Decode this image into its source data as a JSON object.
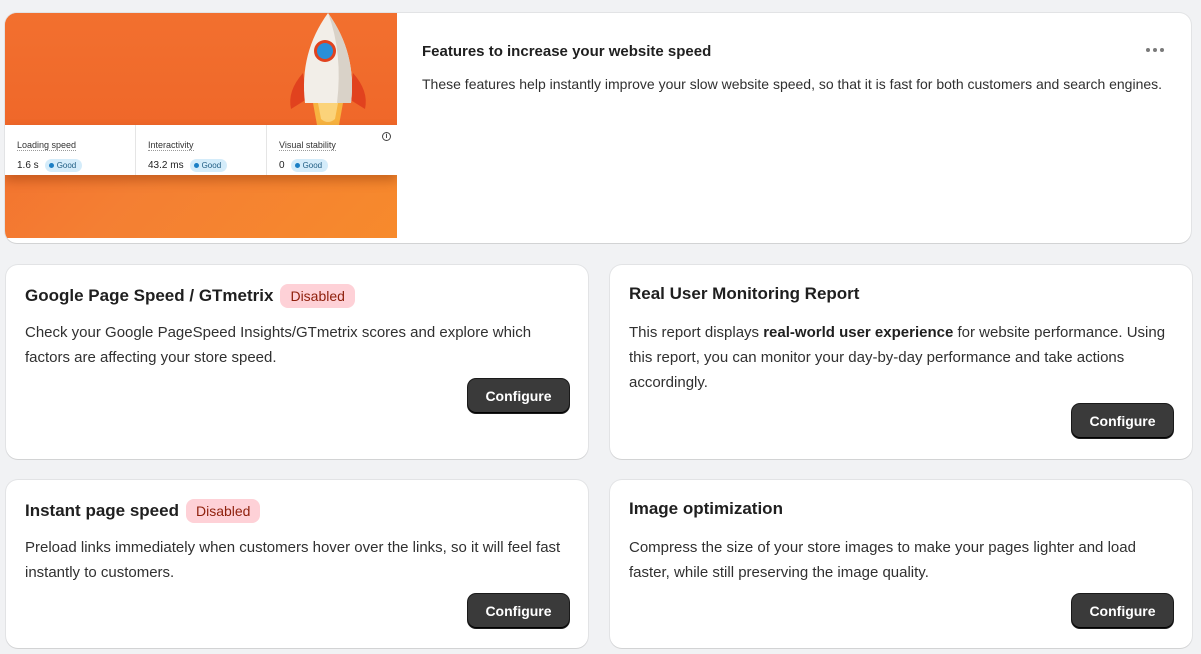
{
  "hero": {
    "title": "Features to increase your website speed",
    "description": "These features help instantly improve your slow website speed, so that it is fast for both customers and search engines.",
    "image": {
      "metrics": [
        {
          "label": "Loading speed",
          "value": "1.6 s",
          "status": "Good"
        },
        {
          "label": "Interactivity",
          "value": "43.2 ms",
          "status": "Good"
        },
        {
          "label": "Visual stability",
          "value": "0",
          "status": "Good"
        }
      ],
      "info_icon": "info-icon",
      "accent": "#f26a2c"
    },
    "menu_icon": "more-horizontal-icon"
  },
  "features": [
    {
      "title": "Google Page Speed / GTmetrix",
      "badge": "Disabled",
      "description": "Check your Google PageSpeed Insights/GTmetrix scores and explore which factors are affecting your store speed.",
      "button": "Configure"
    },
    {
      "title": "Real User Monitoring Report",
      "description_pre": "This report displays ",
      "description_bold": "real-world user experience",
      "description_post": " for website performance. Using this report, you can monitor your day-by-day performance and take actions accordingly.",
      "button": "Configure"
    },
    {
      "title": "Instant page speed",
      "badge": "Disabled",
      "description": "Preload links immediately when customers hover over the links, so it will feel fast instantly to customers.",
      "button": "Configure"
    },
    {
      "title": "Image optimization",
      "description": "Compress the size of your store images to make your pages lighter and load faster, while still preserving the image quality.",
      "button": "Configure"
    }
  ],
  "colors": {
    "background": "#f1f2f4",
    "disabled_badge_bg": "#fed1d7",
    "disabled_badge_text": "#8e1f0b",
    "good_badge_bg": "#d4ecfa",
    "button_bg": "#3a3a3a"
  }
}
